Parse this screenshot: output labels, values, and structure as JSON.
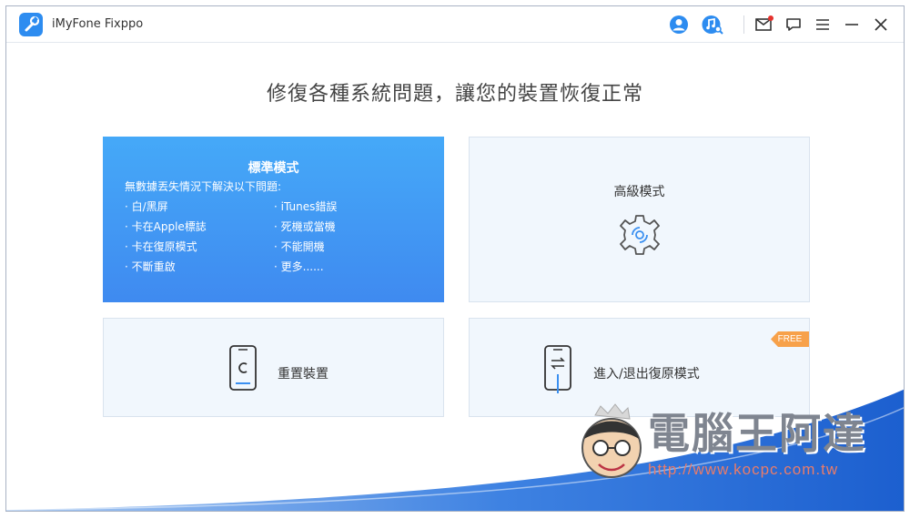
{
  "window": {
    "title": "iMyFone Fixppo"
  },
  "toolbar": {
    "icons": [
      "user-icon",
      "music-search-icon",
      "mail-icon",
      "feedback-icon",
      "menu-icon",
      "minimize-icon",
      "close-icon"
    ],
    "mail_badge_color": "#e5322d"
  },
  "main": {
    "headline": "修復各種系統問題，讓您的裝置恢復正常",
    "standard_mode": {
      "title": "標準模式",
      "subtitle": "無數據丟失情況下解決以下問題:",
      "items": [
        "白/黑屏",
        "iTunes錯誤",
        "卡在Apple標誌",
        "死機或當機",
        "卡在復原模式",
        "不能開機",
        "不斷重啟",
        "更多......"
      ]
    },
    "advanced_mode": {
      "title": "高級模式",
      "icon": "gear-icon"
    },
    "reset_device": {
      "label": "重置裝置",
      "icon": "phone-reset-icon"
    },
    "recovery_mode": {
      "label": "進入/退出復原模式",
      "icon": "phone-cable-icon",
      "badge": "FREE"
    }
  },
  "watermark": {
    "text": "電腦王阿達",
    "url": "http://www.kocpc.com.tw"
  },
  "colors": {
    "accent": "#2d8cf0",
    "standard_card_top": "#45a9f8",
    "standard_card_bottom": "#3f8af0",
    "card_bg": "#f1f7fd",
    "free_badge": "#f7a14a"
  }
}
